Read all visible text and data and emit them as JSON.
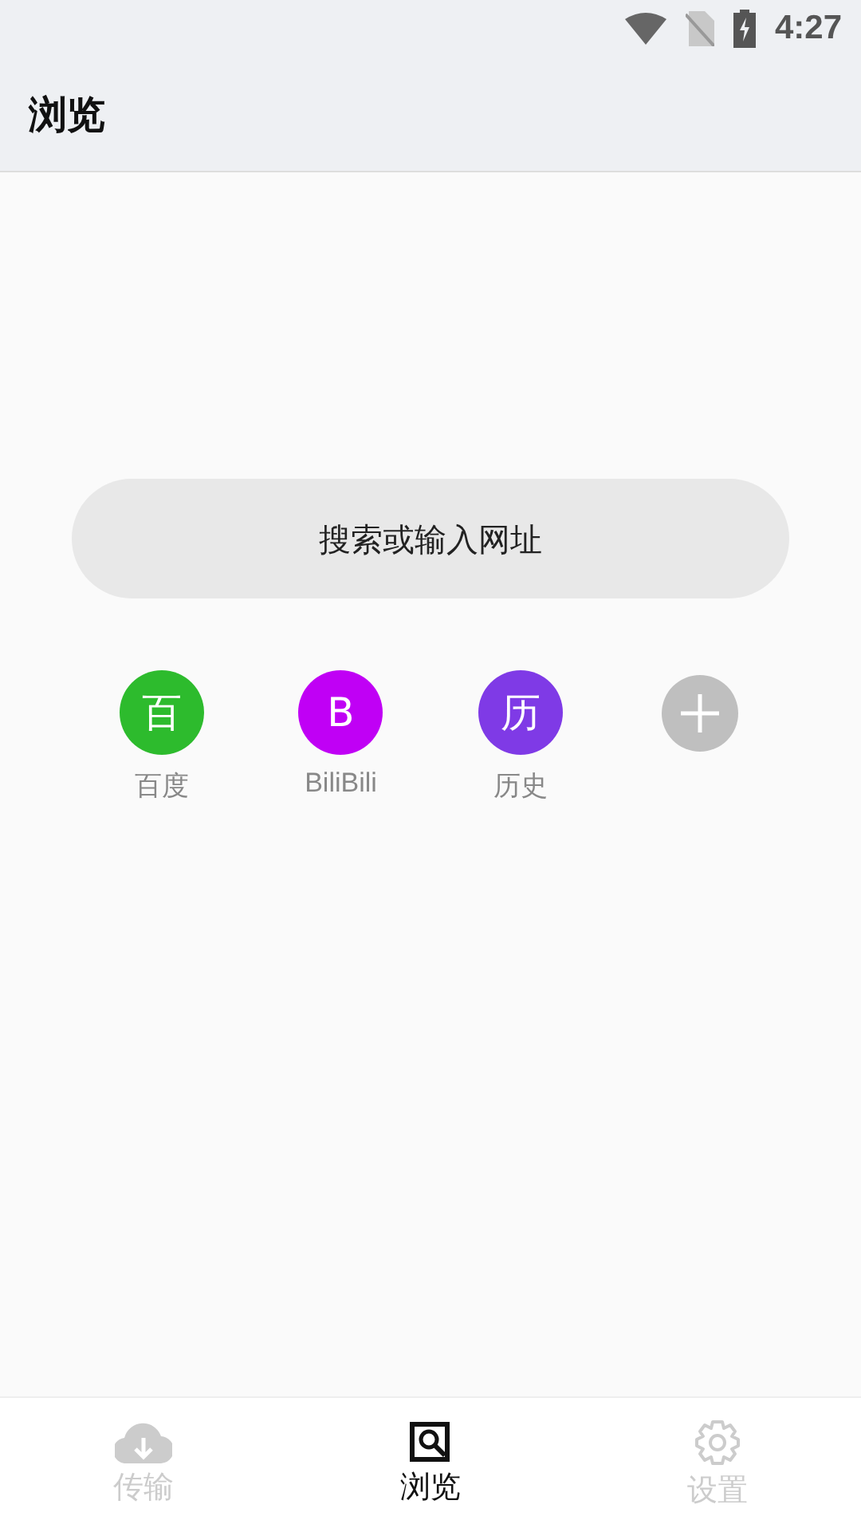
{
  "status_bar": {
    "time": "4:27"
  },
  "app_bar": {
    "title": "浏览"
  },
  "search": {
    "placeholder": "搜索或输入网址"
  },
  "shortcuts": [
    {
      "kind": "letter",
      "glyph": "百",
      "label": "百度",
      "color": "#2dbb2d"
    },
    {
      "kind": "letter",
      "glyph": "B",
      "label": "BiliBili",
      "color": "#c000f5"
    },
    {
      "kind": "letter",
      "glyph": "历",
      "label": "历史",
      "color": "#7f3ae6"
    },
    {
      "kind": "add",
      "color": "#bfbfbf"
    }
  ],
  "bottom_nav": [
    {
      "kind": "cloud",
      "label": "传输",
      "selected": false
    },
    {
      "kind": "browse",
      "label": "浏览",
      "selected": true
    },
    {
      "kind": "gear",
      "label": "设置",
      "selected": false
    }
  ]
}
